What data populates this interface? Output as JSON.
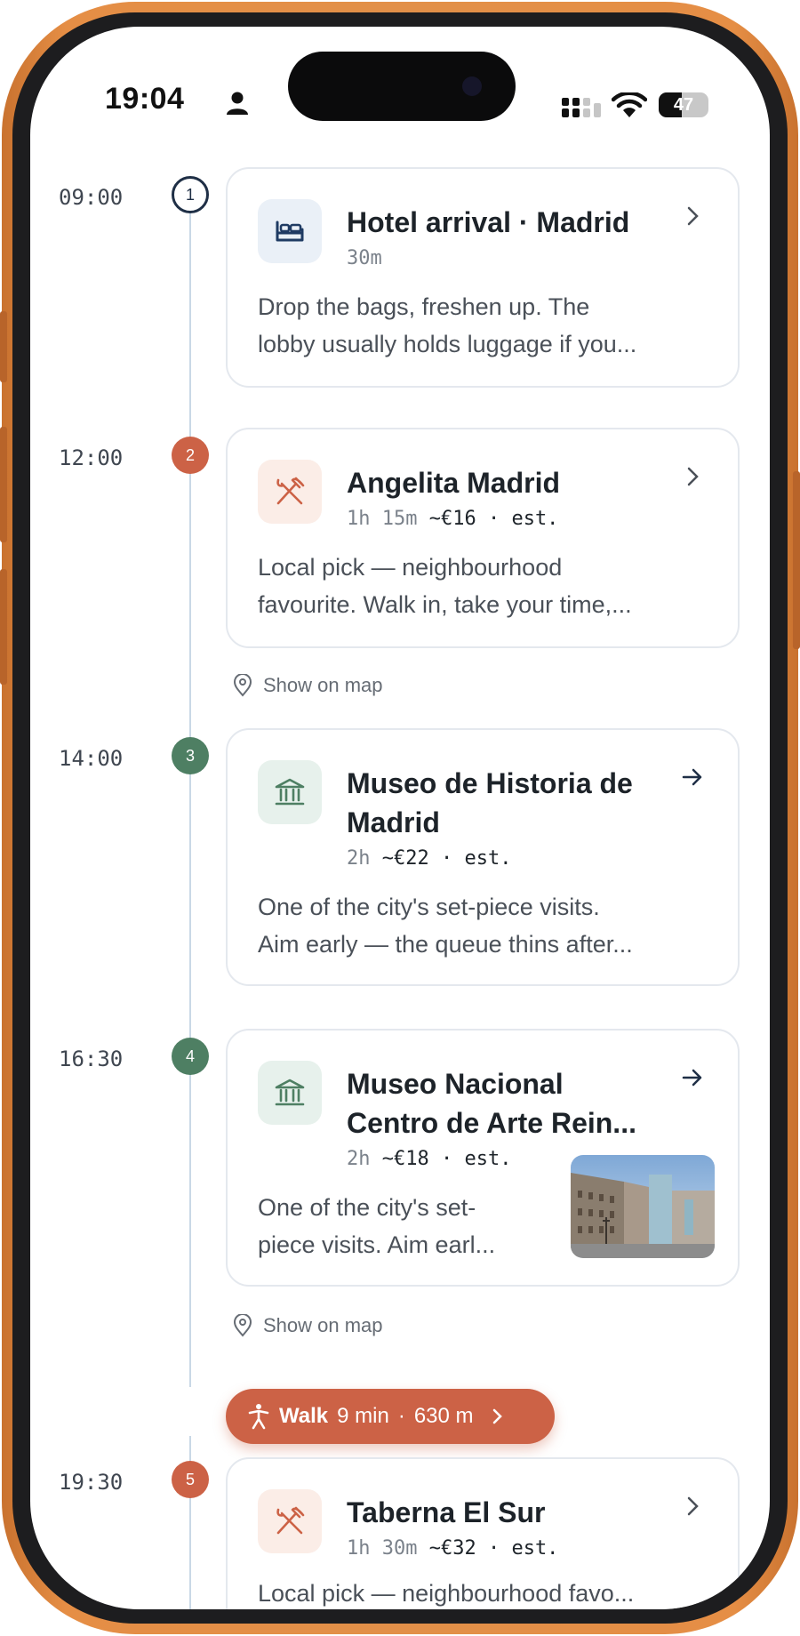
{
  "status_bar": {
    "time": "19:04",
    "battery_level": "47",
    "battery_fraction": 0.47,
    "icons": [
      "person-icon",
      "signal-icon",
      "wifi-icon",
      "battery-icon"
    ]
  },
  "colors": {
    "accent_red": "#cc6246",
    "accent_green": "#4e7f63",
    "navy": "#1f2f46",
    "timeline": "#c9d8e6"
  },
  "stops": [
    {
      "time": "09:00",
      "step": "1",
      "title": "Hotel arrival · Madrid",
      "duration": "30m",
      "cost": "",
      "desc_line1": "Drop the bags, freshen up. The",
      "desc_line2": "lobby usually holds luggage if you...",
      "icon": "bed-icon"
    },
    {
      "time": "12:00",
      "step": "2",
      "title": "Angelita Madrid",
      "duration": "1h 15m",
      "cost": "~€16 · est.",
      "desc_line1": "Local pick — neighbourhood",
      "desc_line2": "favourite. Walk in, take your time,...",
      "icon": "fork-knife-icon",
      "show_map": "Show on map"
    },
    {
      "time": "14:00",
      "step": "3",
      "title_line1": "Museo de Historia de",
      "title_line2": "Madrid",
      "duration": "2h",
      "cost": "~€22 · est.",
      "desc_line1": "One of the city's set-piece visits.",
      "desc_line2": "Aim early — the queue thins after...",
      "icon": "museum-icon"
    },
    {
      "time": "16:30",
      "step": "4",
      "title_line1": "Museo Nacional",
      "title_line2": "Centro de Arte Rein...",
      "duration": "2h",
      "cost": "~€18 · est.",
      "desc_line1": "One of the city's set-",
      "desc_line2": "piece visits. Aim earl...",
      "icon": "museum-icon",
      "show_map": "Show on map"
    },
    {
      "time": "19:30",
      "step": "5",
      "title": "Taberna El Sur",
      "duration": "1h 30m",
      "cost": "~€32 · est.",
      "desc_line1": "Local pick — neighbourhood favo...",
      "icon": "fork-knife-icon"
    }
  ],
  "walk": {
    "label": "Walk",
    "duration": "9 min",
    "separator": "·",
    "distance": "630 m"
  }
}
